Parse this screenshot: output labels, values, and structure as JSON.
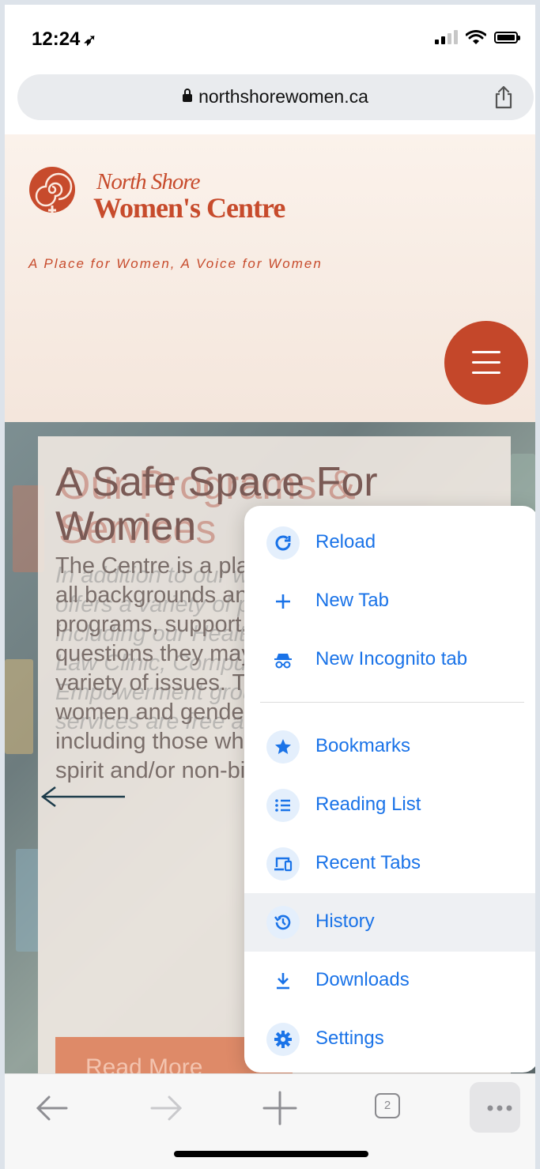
{
  "status_bar": {
    "time": "12:24",
    "location_arrow": "location-arrow-icon"
  },
  "browser": {
    "url": "northshorewomen.ca",
    "tab_count": "2"
  },
  "site": {
    "brand_line1": "North Shore",
    "brand_line2": "Women's Centre",
    "tagline": "A Place for Women, A Voice for Women",
    "hero_title": "A Safe Space For Women",
    "hero_title_ghost": "Our Programs & Services",
    "hero_text": "The Centre is a place where women from all backgrounds and ages come to access programs, support, and answers to questions they may have regarding a variety of issues. The Centre welcomes women and gender diverse individuals, including those who identify as trans, two-spirit and/or non-binary.",
    "hero_text_ghost": "In addition to our weekly Lunch, the NSWC offers a variety of programs & services, including our Health and Wellness, Family Law Clinic, Computer Training, Empowerment groups, and more. All of our services are free and confidential.",
    "read_more": "Read More"
  },
  "menu": {
    "items": [
      {
        "label": "Reload",
        "icon": "reload-icon"
      },
      {
        "label": "New Tab",
        "icon": "plus-icon"
      },
      {
        "label": "New Incognito tab",
        "icon": "incognito-icon"
      },
      {
        "label": "Bookmarks",
        "icon": "star-icon"
      },
      {
        "label": "Reading List",
        "icon": "list-icon"
      },
      {
        "label": "Recent Tabs",
        "icon": "devices-icon"
      },
      {
        "label": "History",
        "icon": "history-icon"
      },
      {
        "label": "Downloads",
        "icon": "download-icon"
      },
      {
        "label": "Settings",
        "icon": "gear-icon"
      }
    ],
    "highlighted": "History"
  },
  "colors": {
    "brand": "#c74b2c",
    "menu_accent": "#1a73e8",
    "menu_icon_bg": "#e4effc"
  }
}
